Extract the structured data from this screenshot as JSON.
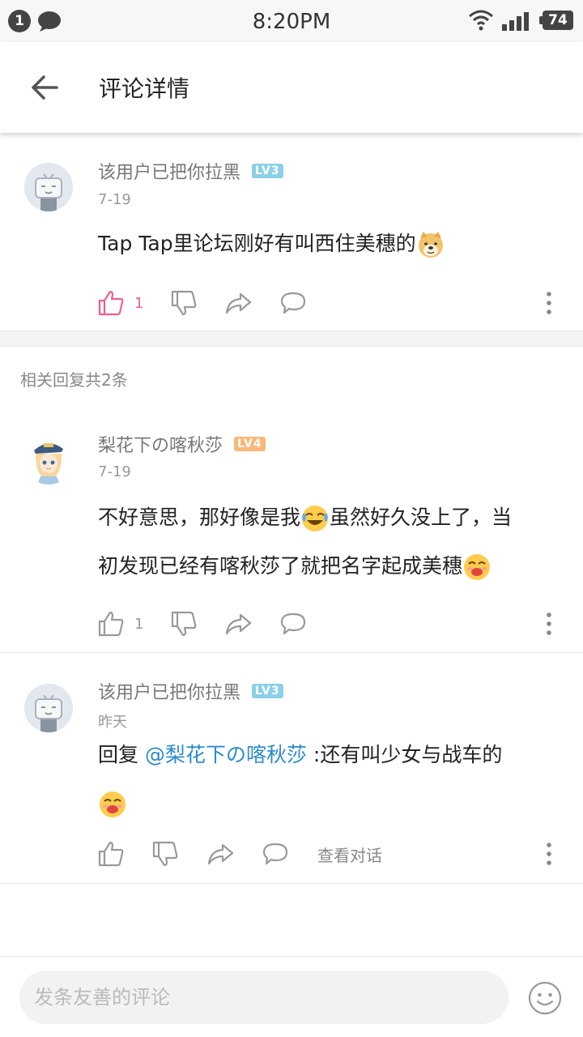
{
  "status_bar": {
    "notification_count": "1",
    "time": "8:20PM",
    "battery": "74"
  },
  "header": {
    "title": "评论详情"
  },
  "main_comment": {
    "username": "该用户已把你拉黑",
    "level": "LV3",
    "date": "7-19",
    "text": "Tap Tap里论坛刚好有叫西住美穗的",
    "like_count": "1"
  },
  "replies_section": {
    "title": "相关回复共2条"
  },
  "replies": [
    {
      "username": "梨花下の喀秋莎",
      "level": "LV4",
      "date": "7-19",
      "text_line1": "不好意思，那好像是我",
      "text_line1b": "虽然好久没上了，当",
      "text_line2": "初发现已经有喀秋莎了就把名字起成美穗",
      "like_count": "1"
    },
    {
      "username": "该用户已把你拉黑",
      "level": "LV3",
      "date": "昨天",
      "reply_prefix": "回复 ",
      "mention": "@梨花下の喀秋莎",
      "text": " :还有叫少女与战车的",
      "view_dialog": "查看对话"
    }
  ],
  "bottom_bar": {
    "placeholder": "发条友善的评论"
  },
  "colors": {
    "like_active": "#f25d8e",
    "mention": "#2a8bd0",
    "lv3": "#8ad0e6",
    "lv4": "#f8b878"
  }
}
